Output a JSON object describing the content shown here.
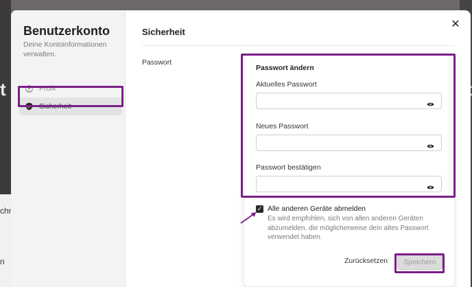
{
  "background": {
    "left_text_large": "t",
    "left_text_mid": "chr",
    "left_text_low": "n",
    "right_text_large": "t"
  },
  "sidebar": {
    "title": "Benutzerkonto",
    "subtitle": "Deine Kontoinformationen verwalten.",
    "items": [
      {
        "label": "Profil",
        "icon": "user-circle-icon",
        "active": false
      },
      {
        "label": "Sicherheit",
        "icon": "shield-icon",
        "active": true
      }
    ]
  },
  "main": {
    "title": "Sicherheit",
    "section_label": "Passwort"
  },
  "password_form": {
    "heading": "Passwort ändern",
    "current_label": "Aktuelles Passwort",
    "current_value": "",
    "new_label": "Neues Passwort",
    "new_value": "",
    "confirm_label": "Passwort bestätigen",
    "confirm_value": "",
    "logout_others_checked": true,
    "logout_others_label": "Alle anderen Geräte abmelden",
    "logout_others_help": "Es wird empfohlen, sich von allen anderen Geräten abzumelden, die möglicherweise dein altes Passwort verwendet haben.",
    "reset_label": "Zurücksetzen",
    "save_label": "Speichern"
  },
  "colors": {
    "highlight": "#7a1f86"
  }
}
